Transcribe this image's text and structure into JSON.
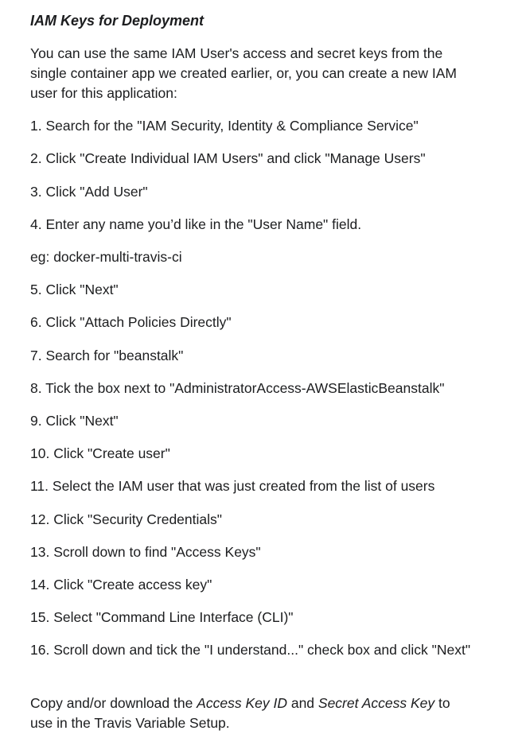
{
  "heading": "IAM Keys for Deployment",
  "intro": "You can use the same IAM User's access and secret keys from the single container app we created earlier, or, you can create a new IAM user for this application:",
  "steps": [
    "1. Search for the \"IAM Security, Identity & Compliance Service\"",
    "2. Click \"Create Individual IAM Users\" and click \"Manage Users\"",
    "3. Click \"Add User\"",
    "4. Enter any name you’d like in the \"User Name\" field.",
    "5. Click \"Next\"",
    "6. Click \"Attach Policies Directly\"",
    "7. Search for \"beanstalk\"",
    "8. Tick the box next to \"AdministratorAccess-AWSElasticBeanstalk\"",
    "9. Click \"Next\"",
    "10. Click \"Create user\"",
    "11. Select the IAM user that was just created from the list of users",
    "12. Click \"Security Credentials\"",
    "13. Scroll down to find \"Access Keys\"",
    "14. Click \"Create access key\"",
    "15. Select \"Command Line Interface (CLI)\"",
    "16. Scroll down and tick the \"I understand...\" check box and click \"Next\""
  ],
  "example": "eg: docker-multi-travis-ci",
  "footer": {
    "prefix": "Copy and/or download the ",
    "access_key_id": "Access Key ID",
    "middle": " and ",
    "secret_access_key": "Secret Access Key",
    "suffix": " to use in the Travis Variable Setup."
  }
}
